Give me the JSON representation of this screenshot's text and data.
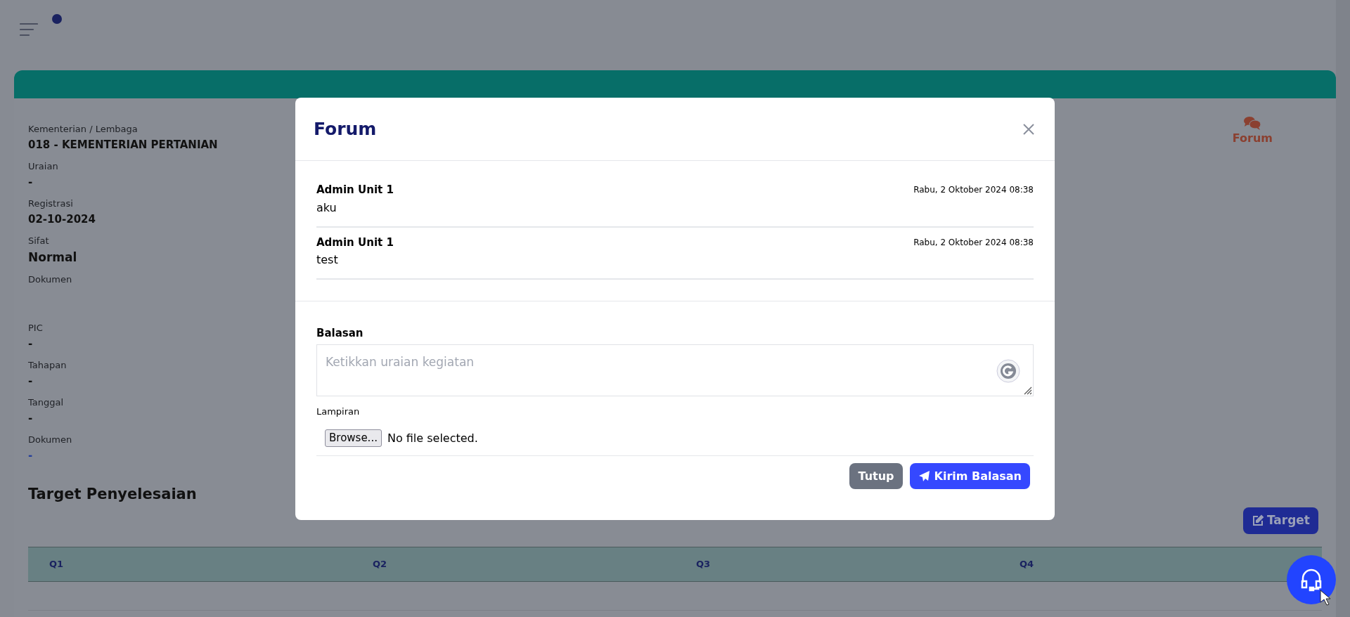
{
  "details": [
    {
      "label": "Kementerian / Lembaga",
      "value": "018 - KEMENTERIAN PERTANIAN",
      "kind": "text"
    },
    {
      "label": "Uraian",
      "value": "-",
      "kind": "text"
    },
    {
      "label": "Registrasi",
      "value": "02-10-2024",
      "kind": "text"
    },
    {
      "label": "Sifat",
      "value": "Normal",
      "kind": "large"
    },
    {
      "label": "Dokumen",
      "kind": "empty"
    },
    {
      "label": "PIC",
      "value": "-",
      "kind": "text"
    },
    {
      "label": "Tahapan",
      "value": "-",
      "kind": "text"
    },
    {
      "label": "Tanggal",
      "value": "-",
      "kind": "text"
    },
    {
      "label": "Dokumen",
      "value": "-",
      "kind": "link"
    }
  ],
  "forum_link": "Forum",
  "section_title": "Target Penyelesaian",
  "target_button": "Target",
  "table": {
    "columns": [
      "Q1",
      "Q2",
      "Q3",
      "Q4"
    ]
  },
  "modal": {
    "title": "Forum",
    "messages": [
      {
        "author": "Admin Unit 1",
        "time": "Rabu, 2 Oktober 2024 08:38",
        "text": "aku"
      },
      {
        "author": "Admin Unit 1",
        "time": "Rabu, 2 Oktober 2024 08:38",
        "text": "test"
      }
    ],
    "reply": {
      "label": "Balasan",
      "placeholder": "Ketikkan uraian kegiatan"
    },
    "attachment": {
      "label": "Lampiran",
      "button": "Browse...",
      "status": "No file selected."
    },
    "buttons": [
      {
        "label": "Tutup",
        "kind": "secondary"
      },
      {
        "label": "Kirim Balasan",
        "kind": "primary"
      }
    ]
  }
}
